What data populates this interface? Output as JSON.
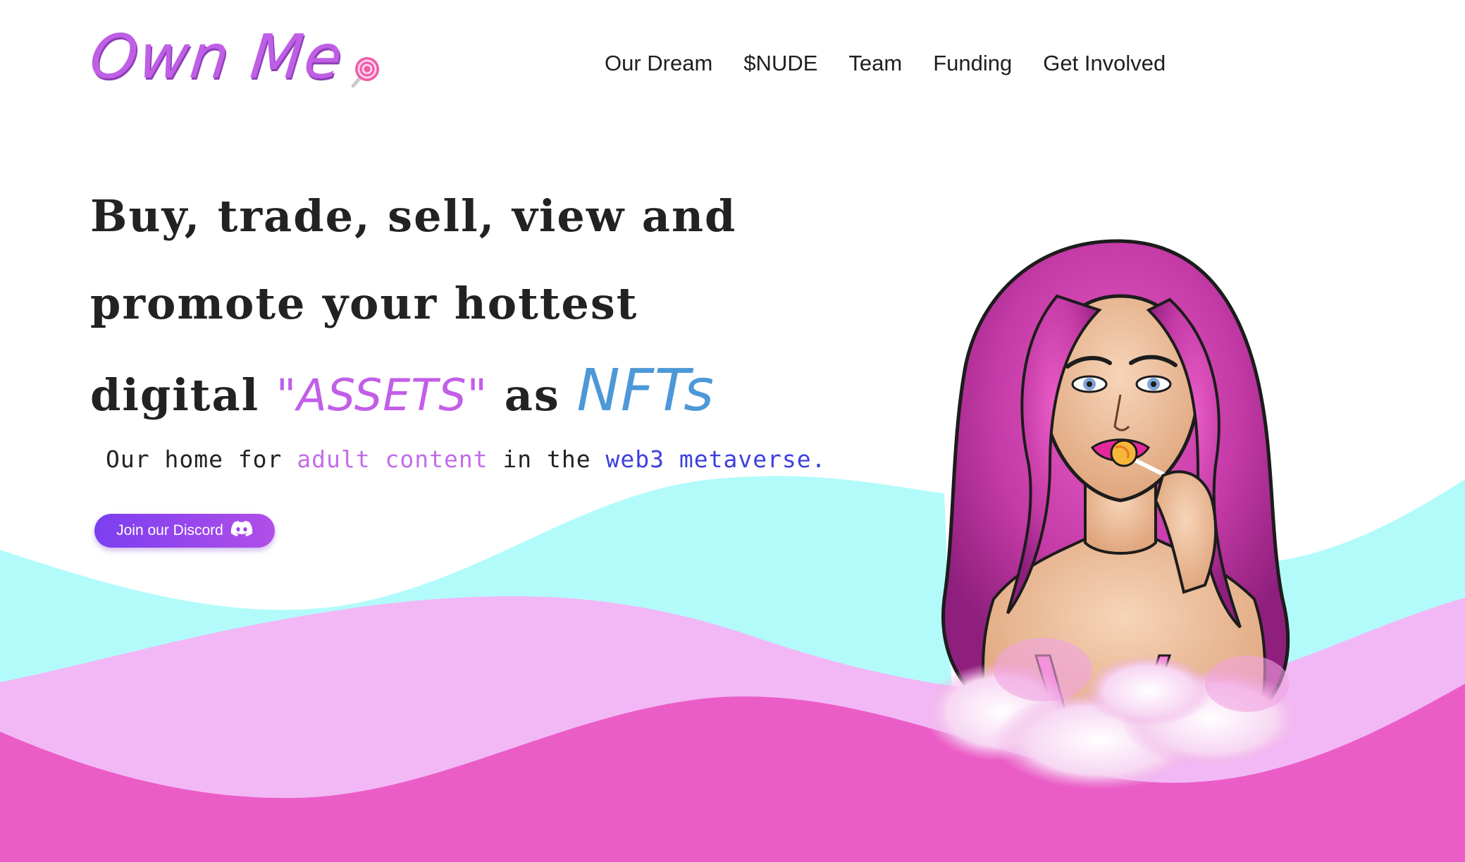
{
  "brand": {
    "logo_text": "Own Me",
    "logo_icon": "lollipop-icon"
  },
  "nav": {
    "items": [
      {
        "label": "Our Dream"
      },
      {
        "label": "$NUDE"
      },
      {
        "label": "Team"
      },
      {
        "label": "Funding"
      },
      {
        "label": "Get Involved"
      }
    ]
  },
  "hero": {
    "line1": "Buy, trade, sell, view and",
    "line2": "promote your hottest",
    "line3_prefix": "digital ",
    "line3_assets": "\"ASSETS\"",
    "line3_as": " as ",
    "line3_nfts": "NFTs",
    "tagline_prefix": "Our home for ",
    "tagline_adult": "adult content",
    "tagline_mid": " in the ",
    "tagline_web3": "web3 metaverse",
    "tagline_suffix": ".",
    "cta_label": "Join our Discord",
    "cta_icon": "discord-icon",
    "illustration": "pink-haired-woman-with-lollipop-illustration"
  },
  "colors": {
    "logo": "#bf5fe6",
    "assets_text": "#c25ee8",
    "nfts_text": "#4d98d8",
    "adult_text": "#c46be8",
    "web3_text": "#3d40dc",
    "wave_cyan": "#b3fbfb",
    "wave_light_pink": "#f2b8f6",
    "wave_magenta": "#eb5dc6",
    "button_start": "#7b3ff0",
    "button_end": "#b14ee8"
  }
}
